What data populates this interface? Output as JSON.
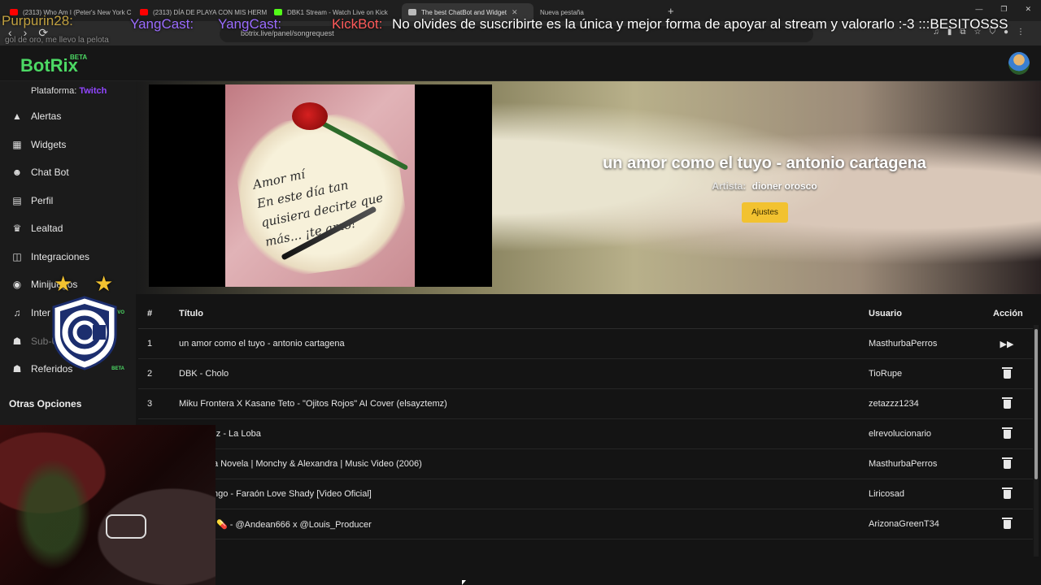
{
  "browser": {
    "tabs": [
      {
        "label": "(2313) Who Am I (Peter's New York C",
        "color": "#ff0000"
      },
      {
        "label": "(2313) DÍA DE PLAYA CON MIS HERM",
        "color": "#ff0000"
      },
      {
        "label": "DBK1 Stream - Watch Live on Kick",
        "color": "#53fc18"
      },
      {
        "label": "The best ChatBot and Widget",
        "color": "#bbbbbb"
      },
      {
        "label": "Nueva pestaña",
        "color": "#666666"
      }
    ],
    "new_tab": "+",
    "url": "botrix.live/panel/songrequest"
  },
  "chat_overlay": {
    "user1": "Purpurin28:",
    "user2": "YangCast:",
    "user3": "YangCast:",
    "bot": "KickBot:",
    "message": "No olvides de suscribirte es la única y mejor forma de apoyar al stream y valorarlo :-3 :::BESITOSSS",
    "small_text": "gol de oro, me llevo la pelota"
  },
  "app": {
    "logo": "BotRix",
    "logo_badge": "BETA"
  },
  "sidebar": {
    "platform_label": "Plataforma:",
    "platform_value": "Twitch",
    "items": [
      {
        "label": "Alertas",
        "icon": "warning-icon"
      },
      {
        "label": "Widgets",
        "icon": "grid-icon"
      },
      {
        "label": "Chat Bot",
        "icon": "robot-icon"
      },
      {
        "label": "Perfil",
        "icon": "id-card-icon"
      },
      {
        "label": "Lealtad",
        "icon": "trophy-icon"
      },
      {
        "label": "Integraciones",
        "icon": "link-icon"
      },
      {
        "label": "Minijuegos",
        "icon": "gamepad-icon"
      },
      {
        "label": "Inter",
        "icon": "music-icon",
        "badge": "VO"
      },
      {
        "label": "Sub-U",
        "icon": "users-icon",
        "disabled": true
      },
      {
        "label": "Referidos",
        "icon": "people-icon",
        "badge": "BETA"
      }
    ],
    "section_title": "Otras Opciones"
  },
  "now_playing": {
    "title": "un amor como el tuyo - antonio cartagena",
    "artist_label": "Artista:",
    "artist": "dioner orosco",
    "settings_button": "Ajustes",
    "thumbnail_text": "Amor mí\nEn este día tan\nquisiera decirte que\nmás... ¡te amo!"
  },
  "queue": {
    "headers": {
      "num": "#",
      "title": "Título",
      "user": "Usuario",
      "action": "Acción"
    },
    "rows": [
      {
        "num": "1",
        "title": "un amor como el tuyo - antonio cartagena",
        "user": "MasthurbaPerros",
        "action": "skip"
      },
      {
        "num": "2",
        "title": "DBK - Cholo",
        "user": "TioRupe",
        "action": "delete"
      },
      {
        "num": "3",
        "title": "Miku Frontera X Kasane Teto - \"Ojitos Rojos\" AI Cover (elsayztemz)",
        "user": "zetazzz1234",
        "action": "delete"
      },
      {
        "num": "",
        "title": "ruz - La Loba",
        "user": "elrevolucionario",
        "action": "delete"
      },
      {
        "num": "",
        "title": "a Novela | Monchy & Alexandra | Music Video (2006)",
        "user": "MasthurbaPerros",
        "action": "delete"
      },
      {
        "num": "",
        "title": "ngo - Faraón Love Shady [Video Oficial]",
        "user": "Liricosad",
        "action": "delete"
      },
      {
        "num": "",
        "title": "💊 - @Andean666 x @Louis_Producer",
        "user": "ArizonaGreenT34",
        "action": "delete"
      }
    ]
  },
  "colors": {
    "accent_green": "#4cd964",
    "twitch_purple": "#9146ff",
    "button_yellow": "#f2c230"
  }
}
